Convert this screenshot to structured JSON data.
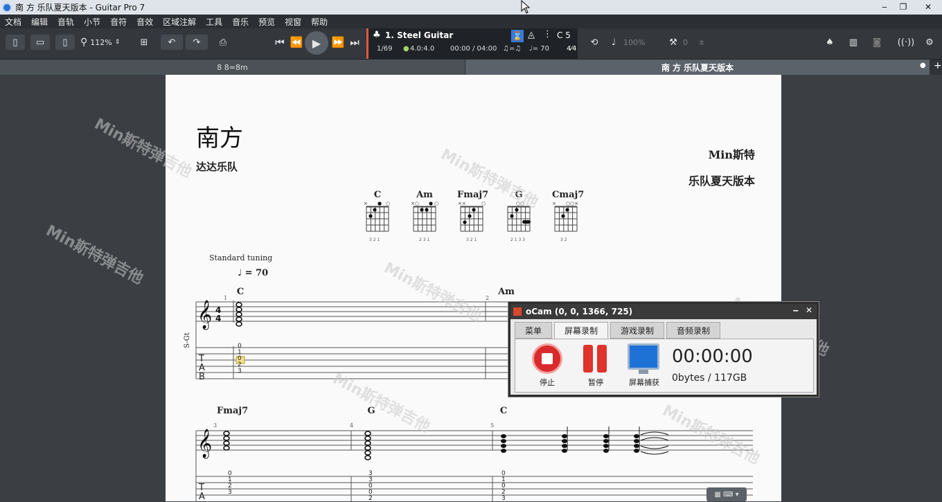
{
  "window": {
    "title": "南 方 乐队夏天版本 - Guitar Pro 7"
  },
  "menu": [
    "文档",
    "编辑",
    "音轨",
    "小节",
    "音符",
    "音效",
    "区域注解",
    "工具",
    "音乐",
    "预览",
    "视窗",
    "帮助"
  ],
  "toolbar": {
    "zoom": "112%"
  },
  "track": {
    "name": "1. Steel Guitar",
    "position": "1/69",
    "signature": "4.0:4.0",
    "time": "00:00 / 04:00",
    "triplet": "♫=♫",
    "tempo": "♩= 70",
    "key": "C 5",
    "volume": "100%",
    "pan": "0"
  },
  "tabs": {
    "left": "8 8=8m",
    "right": "南 方 乐队夏天版本"
  },
  "score": {
    "title": "南方",
    "artist": "达达乐队",
    "music_by": "Min斯特",
    "subtitle": "乐队夏天版本",
    "chords": [
      "C",
      "Am",
      "Fmaj7",
      "G",
      "Cmaj7"
    ],
    "chord_fingers": [
      "3 2 1",
      "2 3 1",
      "3 2 1",
      "2 1 3 3",
      "3 2"
    ],
    "tuning": "Standard tuning",
    "tempo_mark": "= 70",
    "track_label": "S-Gt",
    "bar_chords_row1": [
      "C",
      "Am"
    ],
    "bar_chords_row2": [
      "Fmaj7",
      "G",
      "C"
    ],
    "bar_numbers": [
      "1",
      "2",
      "3",
      "4",
      "5"
    ],
    "tab_row1": [
      "0",
      "1",
      "0",
      "2",
      "3"
    ],
    "tab_row2_bar3": [
      "0",
      "1",
      "2",
      "3"
    ],
    "tab_row2_bar4": [
      "3",
      "3",
      "0",
      "0",
      "2",
      "3"
    ],
    "tab_row2_bar5": [
      "0",
      "1",
      "0",
      "2",
      "3"
    ]
  },
  "ocam": {
    "title": "oCam (0, 0, 1366, 725)",
    "tabs": [
      "菜单",
      "屏幕录制",
      "游戏录制",
      "音频录制"
    ],
    "stop": "停止",
    "pause": "暂停",
    "capture": "屏幕捕获",
    "timer": "00:00:00",
    "size": "0bytes / 117GB"
  },
  "watermark": "Min斯特弹吉他"
}
